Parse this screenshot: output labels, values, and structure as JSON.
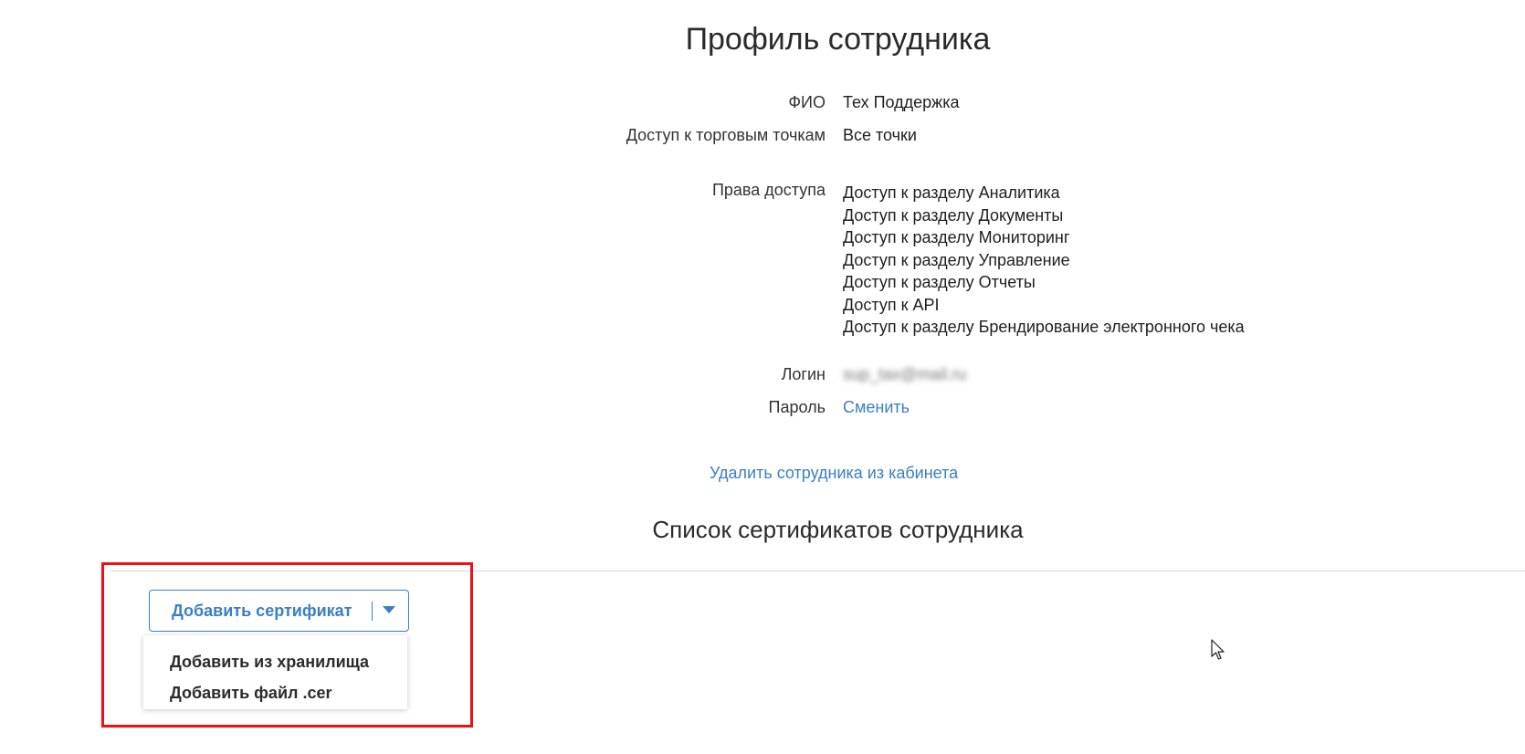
{
  "header": {
    "title": "Профиль сотрудника"
  },
  "profile": {
    "fio_label": "ФИО",
    "fio_value": "Тех Поддержка",
    "access_points_label": "Доступ к торговым точкам",
    "access_points_value": "Все точки",
    "rights_label": "Права доступа",
    "rights": [
      "Доступ к разделу Аналитика",
      "Доступ к разделу Документы",
      "Доступ к разделу Мониторинг",
      "Доступ к разделу Управление",
      "Доступ к разделу Отчеты",
      "Доступ к API",
      "Доступ к разделу Брендирование электронного чека"
    ],
    "login_label": "Логин",
    "login_value": "sup_tax@mail.ru",
    "password_label": "Пароль",
    "password_change_link": "Сменить",
    "delete_link": "Удалить сотрудника из кабинета"
  },
  "certificates": {
    "section_title": "Список сертификатов сотрудника",
    "add_button_label": "Добавить сертификат",
    "dropdown_items": [
      "Добавить из хранилища",
      "Добавить файл .cer"
    ]
  },
  "colors": {
    "accent": "#3a7fc4",
    "highlight": "#ee1111"
  }
}
